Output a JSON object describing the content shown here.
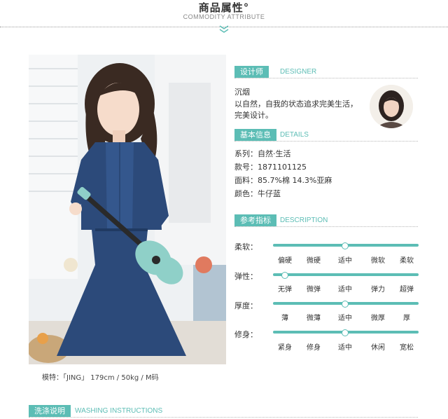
{
  "header": {
    "title": "商品属性°",
    "subtitle": "COMMODITY ATTRIBUTE"
  },
  "photo": {
    "caption": "模特：「JING」 179cm / 50kg / M码"
  },
  "designer": {
    "tag": "设计师",
    "en": "DESIGNER",
    "name": "沉烟",
    "desc_line1": "以自然，自我的状态追求完美生活，",
    "desc_line2": "完美设计。"
  },
  "details": {
    "tag": "基本信息",
    "en": "DETAILS",
    "rows": [
      "系列：自然·生活",
      "款号：1871101125",
      "面料：85.7%棉 14.3%亚麻",
      "颜色：牛仔蓝"
    ]
  },
  "description": {
    "tag": "参考指标",
    "en": "DESCRIPTION",
    "metrics": [
      {
        "label": "柔软：",
        "options": [
          "偏硬",
          "微硬",
          "适中",
          "微软",
          "柔软"
        ],
        "selected": 2
      },
      {
        "label": "弹性：",
        "options": [
          "无弹",
          "微弹",
          "适中",
          "弹力",
          "超弹"
        ],
        "selected": 0
      },
      {
        "label": "厚度：",
        "options": [
          "薄",
          "微薄",
          "适中",
          "微厚",
          "厚"
        ],
        "selected": 2
      },
      {
        "label": "修身：",
        "options": [
          "紧身",
          "修身",
          "适中",
          "休闲",
          "宽松"
        ],
        "selected": 2
      }
    ]
  },
  "washing": {
    "tag": "洗涤说明",
    "en": "WASHING INSTRUCTIONS"
  },
  "colors": {
    "accent": "#5cbdb5",
    "denim": "#2c4a7a"
  }
}
